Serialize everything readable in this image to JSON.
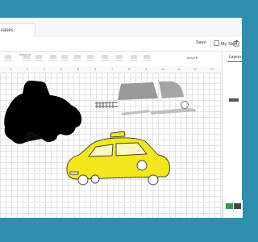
{
  "tab": {
    "title": "vases"
  },
  "header": {
    "save_label": "Save",
    "my_stuff_label": "My Stuff"
  },
  "toolbar": {
    "select_label": "Select All",
    "move_label": "Move ▾"
  },
  "ruler": {
    "ticks": [
      "1",
      "2",
      "3",
      "4",
      "5",
      "6",
      "7",
      "8",
      "9",
      "10",
      "11",
      "12",
      "13"
    ]
  },
  "layers": {
    "title": "Layers"
  },
  "colors": {
    "accent": "#1a8fbf",
    "taxi_yellow": "#f2e61c",
    "silhouette": "#000000",
    "outline": "#3a3a3a",
    "background": "#2f8fb0",
    "bottom_green": "#2e9b53"
  },
  "icons": [
    "share-icon",
    "folder-icon",
    "select-all-icon",
    "edit-icon",
    "align-icon",
    "arrange-icon",
    "flip-icon",
    "size-icon",
    "rotate-icon",
    "position-icon",
    "eye-icon"
  ]
}
